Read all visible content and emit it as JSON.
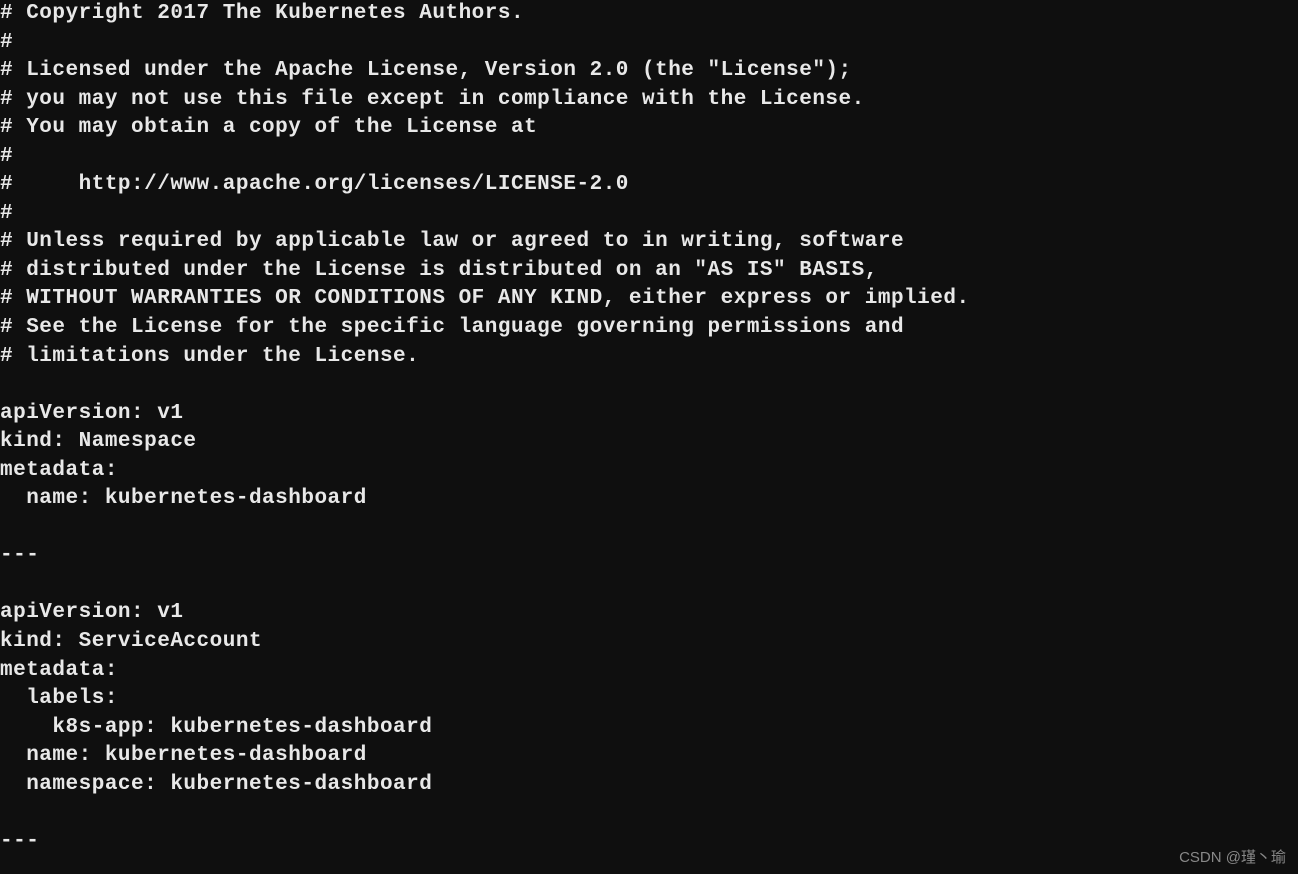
{
  "code_lines": [
    "# Copyright 2017 The Kubernetes Authors.",
    "#",
    "# Licensed under the Apache License, Version 2.0 (the \"License\");",
    "# you may not use this file except in compliance with the License.",
    "# You may obtain a copy of the License at",
    "#",
    "#     http://www.apache.org/licenses/LICENSE-2.0",
    "#",
    "# Unless required by applicable law or agreed to in writing, software",
    "# distributed under the License is distributed on an \"AS IS\" BASIS,",
    "# WITHOUT WARRANTIES OR CONDITIONS OF ANY KIND, either express or implied.",
    "# See the License for the specific language governing permissions and",
    "# limitations under the License.",
    "",
    "apiVersion: v1",
    "kind: Namespace",
    "metadata:",
    "  name: kubernetes-dashboard",
    "",
    "---",
    "",
    "apiVersion: v1",
    "kind: ServiceAccount",
    "metadata:",
    "  labels:",
    "    k8s-app: kubernetes-dashboard",
    "  name: kubernetes-dashboard",
    "  namespace: kubernetes-dashboard",
    "",
    "---"
  ],
  "watermark": "CSDN @瑾丶瑜"
}
